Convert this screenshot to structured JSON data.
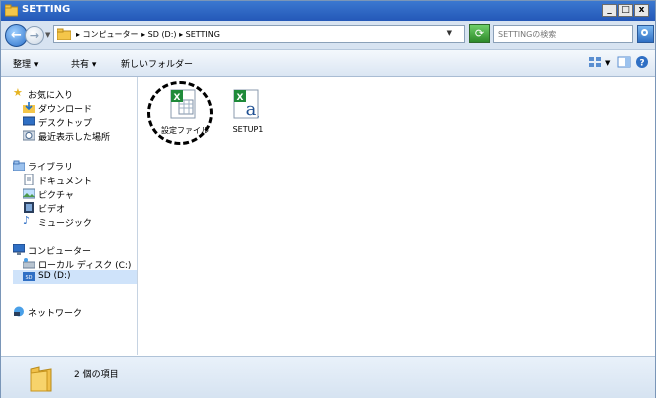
{
  "window": {
    "title": "SETTING",
    "min": "_",
    "max": "□",
    "close": "x"
  },
  "address": {
    "crumbs": "▸ コンピューター ▸ SD (D:) ▸ SETTING",
    "refresh_glyph": "⟳",
    "search_placeholder": "SETTINGの検索"
  },
  "commandbar": {
    "organize": "整理 ▾",
    "share": "共有 ▾",
    "new_folder": "新しいフォルダー"
  },
  "navpane": {
    "favorites": {
      "label": "お気に入り",
      "items": [
        "ダウンロード",
        "デスクトップ",
        "最近表示した場所"
      ]
    },
    "libraries": {
      "label": "ライブラリ",
      "items": [
        "ドキュメント",
        "ピクチャ",
        "ビデオ",
        "ミュージック"
      ]
    },
    "computer": {
      "label": "コンピューター",
      "items": [
        "ローカル ディスク (C:)",
        "SD (D:)"
      ]
    },
    "network": {
      "label": "ネットワーク"
    }
  },
  "files": [
    {
      "name": "設定ファイル",
      "icon": "excel-csv-icon"
    },
    {
      "name": "SETUP1",
      "icon": "excel-text-icon"
    }
  ],
  "details": {
    "count": "2 個の項目"
  },
  "colors": {
    "titlebar": "#2458b8",
    "selected": "#cfe3fa",
    "pane_bg": "#d6e3f1"
  }
}
